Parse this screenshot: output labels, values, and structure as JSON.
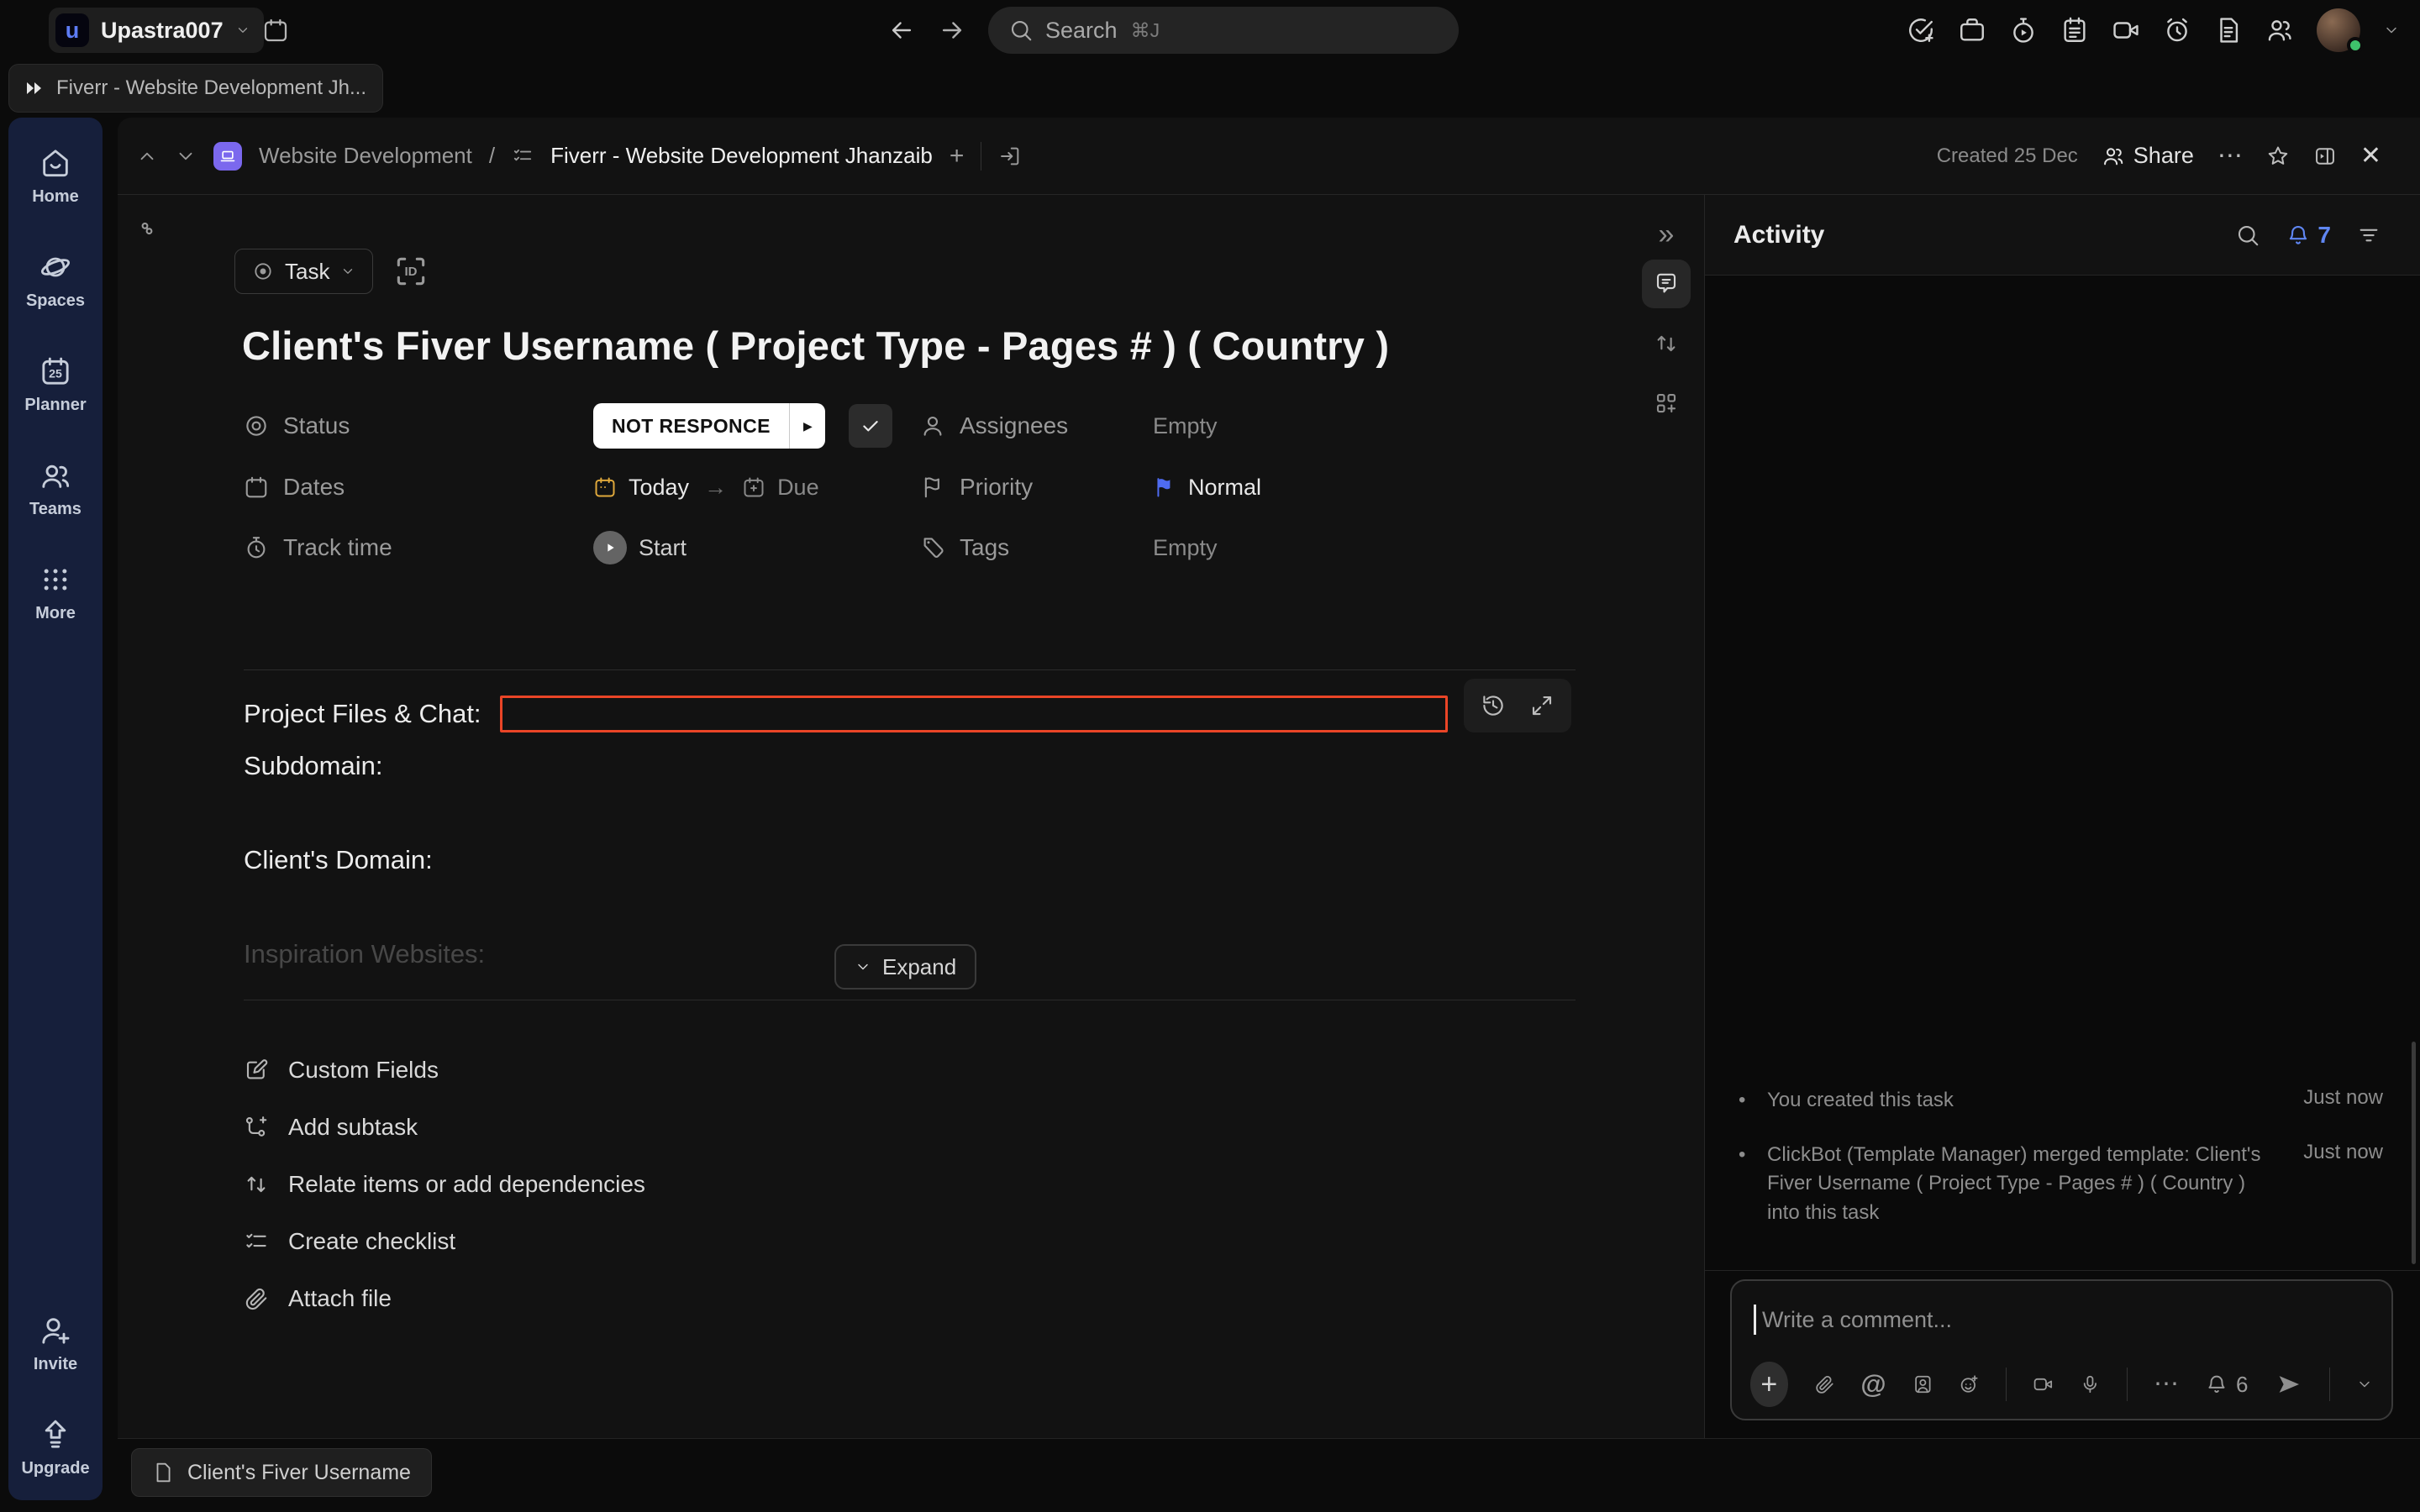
{
  "colors": {
    "accent_blue": "#5f86f2",
    "priority_flag_blue": "#4e6bf0",
    "highlight_red": "#ea4527",
    "date_yellow": "#e0a93c",
    "online_green": "#3ec26b",
    "space_purple": "#7b68ee",
    "sidebar_navy": "#161f3b"
  },
  "topbar": {
    "workspace_name": "Upastra007",
    "search_placeholder": "Search",
    "search_shortcut": "⌘J"
  },
  "tab_bar": {
    "active_tab": "Fiverr - Website Development Jh..."
  },
  "sidebar": {
    "items": [
      {
        "label": "Home"
      },
      {
        "label": "Spaces"
      },
      {
        "label": "Planner"
      },
      {
        "label": "Teams"
      },
      {
        "label": "More"
      }
    ],
    "footer_items": [
      {
        "label": "Invite"
      },
      {
        "label": "Upgrade"
      }
    ],
    "planner_day": "25"
  },
  "modal": {
    "breadcrumb": {
      "space": "Website Development",
      "separator": "/",
      "task_name": "Fiverr - Website Development Jhanzaib"
    },
    "header": {
      "created": "Created 25 Dec",
      "share_label": "Share"
    },
    "task_type_label": "Task",
    "title": "Client's Fiver Username ( Project Type - Pages # ) ( Country )",
    "fields": {
      "status": {
        "label": "Status",
        "value": "NOT RESPONCE"
      },
      "assignees": {
        "label": "Assignees",
        "value": "Empty"
      },
      "dates": {
        "label": "Dates",
        "start_value": "Today",
        "due_label": "Due"
      },
      "priority": {
        "label": "Priority",
        "value": "Normal"
      },
      "track_time": {
        "label": "Track time",
        "value": "Start"
      },
      "tags": {
        "label": "Tags",
        "value": "Empty"
      }
    },
    "description": {
      "line1": "Project Files & Chat:",
      "line2": "Subdomain:",
      "line3": "Client's Domain:",
      "line4": "Inspiration Websites:",
      "expand_label": "Expand"
    },
    "actions": [
      {
        "label": "Custom Fields"
      },
      {
        "label": "Add subtask"
      },
      {
        "label": "Relate items or add dependencies"
      },
      {
        "label": "Create checklist"
      },
      {
        "label": "Attach file"
      }
    ]
  },
  "activity": {
    "title": "Activity",
    "notification_count": "7",
    "items": [
      {
        "text": "You created this task",
        "time": "Just now"
      },
      {
        "text": "ClickBot (Template Manager) merged template: Client's Fiver Username ( Project Type - Pages # ) ( Country ) into this task",
        "time": "Just now"
      }
    ],
    "comment_box": {
      "placeholder": "Write a comment...",
      "bell_count": "6"
    }
  },
  "bottom_bar": {
    "open_task": "Client's Fiver Username"
  },
  "glyphs": {
    "slash": "/",
    "plus": "+",
    "ellipsis": "⋯",
    "close": "✕",
    "collapse": "»",
    "arrow_right": "→",
    "caret_right": "▶",
    "at_sign": "@",
    "id_badge": "ID",
    "logo_letter": "u",
    "bullet": "•"
  }
}
